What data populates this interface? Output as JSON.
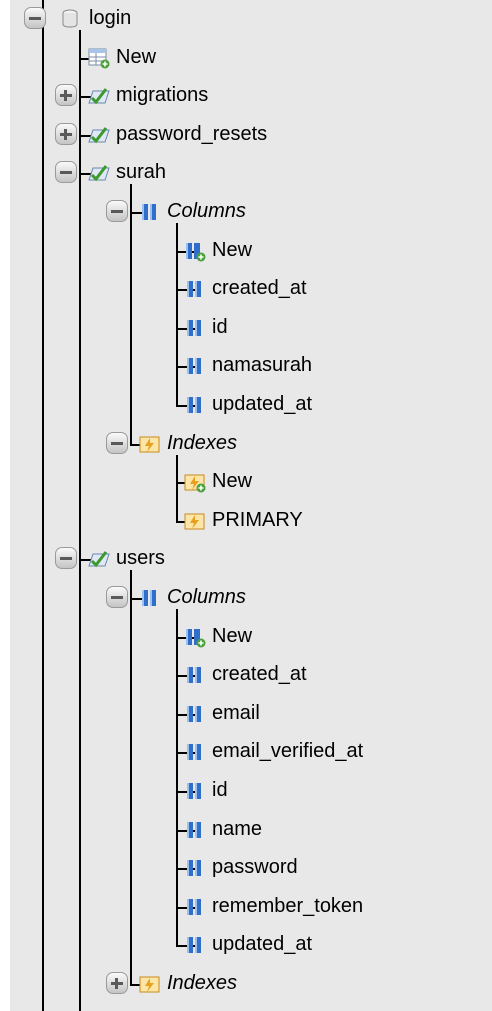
{
  "database": {
    "name": "login",
    "items": [
      {
        "label": "New",
        "icon": "new-table-icon",
        "state": "leaf"
      },
      {
        "label": "migrations",
        "icon": "table-icon",
        "state": "collapsed"
      },
      {
        "label": "password_resets",
        "icon": "table-icon",
        "state": "collapsed"
      },
      {
        "label": "surah",
        "icon": "table-icon",
        "state": "expanded",
        "columns_label": "Columns",
        "columns": [
          "New",
          "created_at",
          "id",
          "namasurah",
          "updated_at"
        ],
        "indexes_label": "Indexes",
        "indexes": [
          "New",
          "PRIMARY"
        ]
      },
      {
        "label": "users",
        "icon": "table-icon",
        "state": "expanded",
        "columns_label": "Columns",
        "columns": [
          "New",
          "created_at",
          "email",
          "email_verified_at",
          "id",
          "name",
          "password",
          "remember_token",
          "updated_at"
        ],
        "indexes_label": "Indexes",
        "indexes_state": "collapsed"
      }
    ]
  },
  "colors": {
    "background": "#e8e8e8",
    "column_icon": "#2f6fc9",
    "table_icon_check": "#3a9a2a",
    "index_icon": "#e8a020",
    "new_badge": "#4aa03a"
  }
}
